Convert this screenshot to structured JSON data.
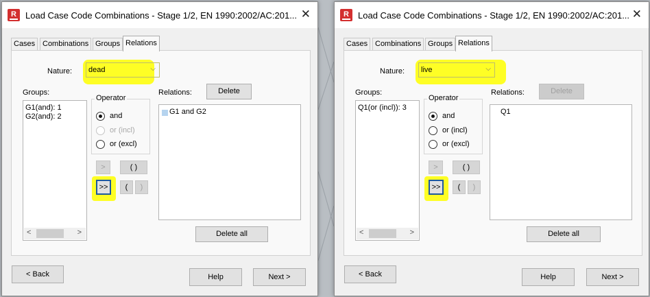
{
  "dialogs": {
    "left": {
      "title": "Load Case Code Combinations - Stage 1/2, EN 1990:2002/AC:201...",
      "tabs": [
        "Cases",
        "Combinations",
        "Groups",
        "Relations"
      ],
      "nature_label": "Nature:",
      "nature_value": "dead",
      "groups_label": "Groups:",
      "groups_items": [
        "G1(and): 1",
        "G2(and): 2"
      ],
      "operator_label": "Operator",
      "operators": [
        "and",
        "or (incl)",
        "or (excl)"
      ],
      "operator_selected": "and",
      "add_button": ">",
      "add_all_button": ">>",
      "paren_pair_button": "( )",
      "open_paren_button": "(",
      "close_paren_button": ")",
      "relations_label": "Relations:",
      "delete_button": "Delete",
      "relations_items": [
        "G1 and G2"
      ],
      "delete_all_button": "Delete all",
      "back_button": "< Back",
      "help_button": "Help",
      "next_button": "Next >"
    },
    "right": {
      "title": "Load Case Code Combinations - Stage 1/2, EN 1990:2002/AC:201...",
      "tabs": [
        "Cases",
        "Combinations",
        "Groups",
        "Relations"
      ],
      "nature_label": "Nature:",
      "nature_value": "live",
      "groups_label": "Groups:",
      "groups_items": [
        "Q1(or (incl)): 3"
      ],
      "operator_label": "Operator",
      "operators": [
        "and",
        "or (incl)",
        "or (excl)"
      ],
      "operator_selected": "and",
      "add_button": ">",
      "add_all_button": ">>",
      "paren_pair_button": "( )",
      "open_paren_button": "(",
      "close_paren_button": ")",
      "relations_label": "Relations:",
      "delete_button": "Delete",
      "relations_items": [
        "Q1"
      ],
      "delete_all_button": "Delete all",
      "back_button": "< Back",
      "help_button": "Help",
      "next_button": "Next >"
    }
  },
  "colors": {
    "highlight": "#ffff00",
    "accent_border": "#1e5a9e",
    "app_icon": "#d32f2f"
  },
  "icons": {
    "app": "autodesk-robot-icon",
    "close": "close-icon",
    "dropdown": "chevron-down-icon"
  }
}
